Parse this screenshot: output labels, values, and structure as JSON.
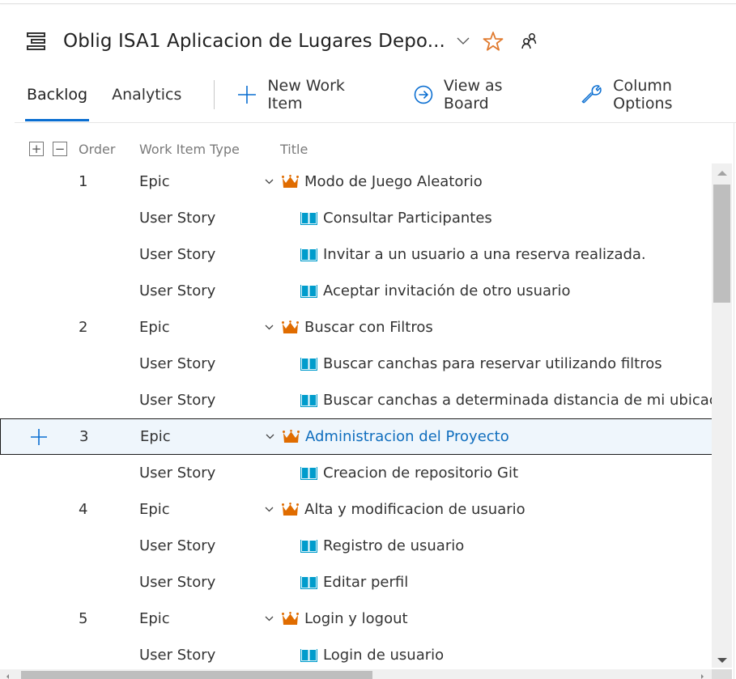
{
  "header": {
    "title": "Oblig ISA1 Aplicacion de Lugares Depo...",
    "title_icon": "backlog-icon",
    "favorite_icon": "star-icon",
    "team_icon": "people-icon",
    "colors": {
      "star": "#e07a2e",
      "accent": "#0a6ed1"
    }
  },
  "toolbar": {
    "tabs": [
      {
        "label": "Backlog",
        "active": true
      },
      {
        "label": "Analytics",
        "active": false
      }
    ],
    "new_work_item_label": "New Work Item",
    "view_as_board_label": "View as Board",
    "column_options_label": "Column Options"
  },
  "grid": {
    "columns": {
      "order": "Order",
      "type": "Work Item Type",
      "title": "Title"
    },
    "expand_all_symbol": "+",
    "collapse_all_symbol": "−",
    "selected_row_index": 7,
    "colors": {
      "epic_icon": "#e06c00",
      "story_icon": "#009ccc",
      "selected_bg": "#eff6fc",
      "selected_title": "#106ebe"
    },
    "rows": [
      {
        "order": "1",
        "type": "Epic",
        "title": "Modo de Juego Aleatorio",
        "kind": "epic"
      },
      {
        "order": "",
        "type": "User Story",
        "title": "Consultar Participantes",
        "kind": "story"
      },
      {
        "order": "",
        "type": "User Story",
        "title": "Invitar a un usuario a una reserva realizada.",
        "kind": "story"
      },
      {
        "order": "",
        "type": "User Story",
        "title": "Aceptar invitación de otro usuario",
        "kind": "story"
      },
      {
        "order": "2",
        "type": "Epic",
        "title": "Buscar con Filtros",
        "kind": "epic"
      },
      {
        "order": "",
        "type": "User Story",
        "title": "Buscar canchas para reservar utilizando filtros",
        "kind": "story"
      },
      {
        "order": "",
        "type": "User Story",
        "title": "Buscar canchas a determinada distancia de mi ubicación",
        "kind": "story"
      },
      {
        "order": "3",
        "type": "Epic",
        "title": "Administracion del Proyecto",
        "kind": "epic"
      },
      {
        "order": "",
        "type": "User Story",
        "title": "Creacion de repositorio Git",
        "kind": "story"
      },
      {
        "order": "4",
        "type": "Epic",
        "title": "Alta y modificacion de usuario",
        "kind": "epic"
      },
      {
        "order": "",
        "type": "User Story",
        "title": "Registro de usuario",
        "kind": "story"
      },
      {
        "order": "",
        "type": "User Story",
        "title": "Editar perfil",
        "kind": "story"
      },
      {
        "order": "5",
        "type": "Epic",
        "title": "Login y logout",
        "kind": "epic"
      },
      {
        "order": "",
        "type": "User Story",
        "title": "Login de usuario",
        "kind": "story"
      }
    ]
  }
}
